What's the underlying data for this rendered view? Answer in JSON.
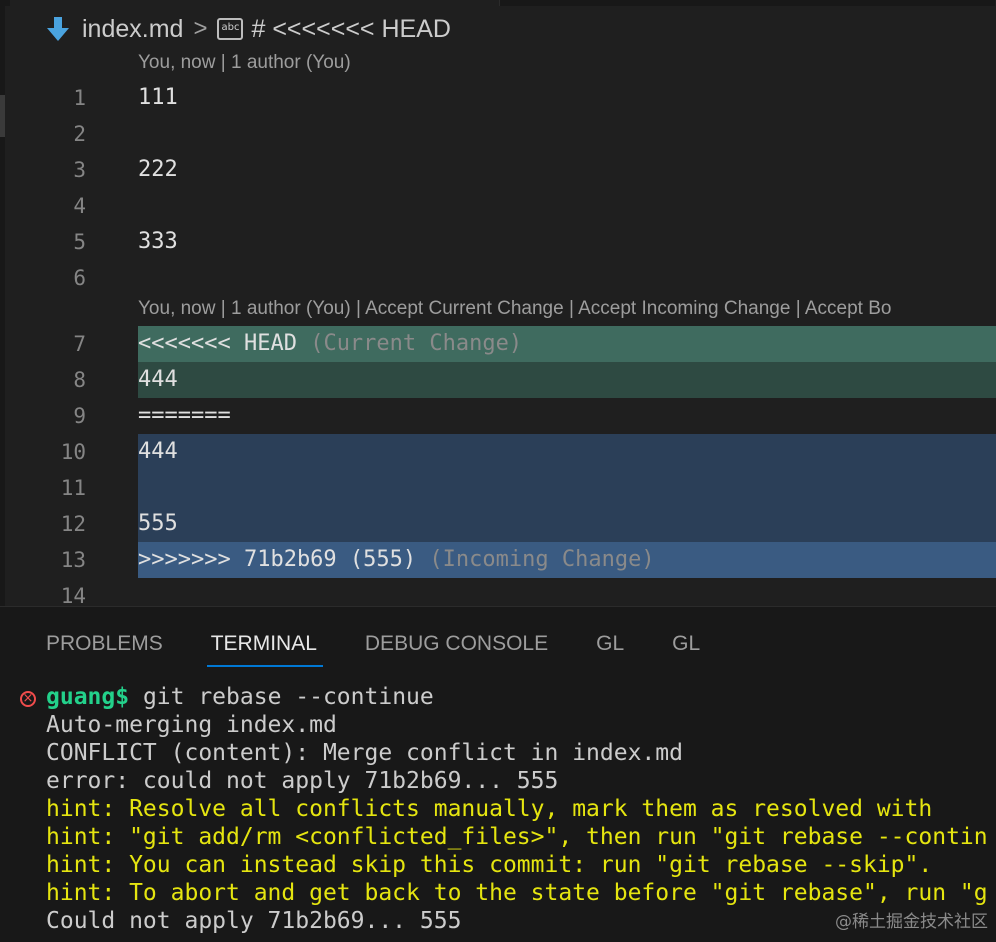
{
  "breadcrumb": {
    "file_icon": "markdown-down-arrow-icon",
    "file": "index.md",
    "separator": ">",
    "symbol_icon": "string-symbol-icon",
    "symbol_icon_text": "abc",
    "symbol": "# <<<<<<< HEAD"
  },
  "codelens": {
    "top": "You, now | 1 author (You)",
    "conflict": "You, now | 1 author (You) | Accept Current Change | Accept Incoming Change | Accept Bo"
  },
  "lines": [
    {
      "num": "1",
      "text": "111"
    },
    {
      "num": "2",
      "text": ""
    },
    {
      "num": "3",
      "text": "222"
    },
    {
      "num": "4",
      "text": ""
    },
    {
      "num": "5",
      "text": "333"
    },
    {
      "num": "6",
      "text": ""
    },
    {
      "num": "7",
      "text": "<<<<<<< HEAD",
      "hint": " (Current Change)"
    },
    {
      "num": "8",
      "text": "444"
    },
    {
      "num": "9",
      "text": "======="
    },
    {
      "num": "10",
      "text": "444"
    },
    {
      "num": "11",
      "text": ""
    },
    {
      "num": "12",
      "text": "555"
    },
    {
      "num": "13",
      "text": ">>>>>>> 71b2b69 (555)",
      "hint": " (Incoming Change)"
    },
    {
      "num": "14",
      "text": ""
    }
  ],
  "colors": {
    "current_header": "#3f6b5f",
    "current_body": "#2e4a42",
    "incoming_body": "#2b3f58",
    "incoming_header": "#3a5b82",
    "prompt": "#23d18b",
    "hint": "#e5e510",
    "error": "#f14c4c",
    "tab_underline": "#0078d4"
  },
  "panel": {
    "tabs": [
      {
        "label": "PROBLEMS"
      },
      {
        "label": "TERMINAL",
        "active": true
      },
      {
        "label": "DEBUG CONSOLE"
      },
      {
        "label": "GL"
      },
      {
        "label": "GL"
      }
    ]
  },
  "terminal": {
    "status_icon": "error-circle-icon",
    "status_icon_glyph": "×",
    "prompt": "guang$",
    "command": " git rebase --continue",
    "output": [
      {
        "text": "Auto-merging index.md",
        "kind": "normal"
      },
      {
        "text": "CONFLICT (content): Merge conflict in index.md",
        "kind": "normal"
      },
      {
        "text": "error: could not apply 71b2b69... 555",
        "kind": "normal"
      },
      {
        "text": "hint: Resolve all conflicts manually, mark them as resolved with",
        "kind": "hint"
      },
      {
        "text": "hint: \"git add/rm <conflicted_files>\", then run \"git rebase --contin",
        "kind": "hint"
      },
      {
        "text": "hint: You can instead skip this commit: run \"git rebase --skip\".",
        "kind": "hint"
      },
      {
        "text": "hint: To abort and get back to the state before \"git rebase\", run \"g",
        "kind": "hint"
      },
      {
        "text": "Could not apply 71b2b69... 555",
        "kind": "normal"
      }
    ]
  },
  "watermark": "@稀土掘金技术社区"
}
